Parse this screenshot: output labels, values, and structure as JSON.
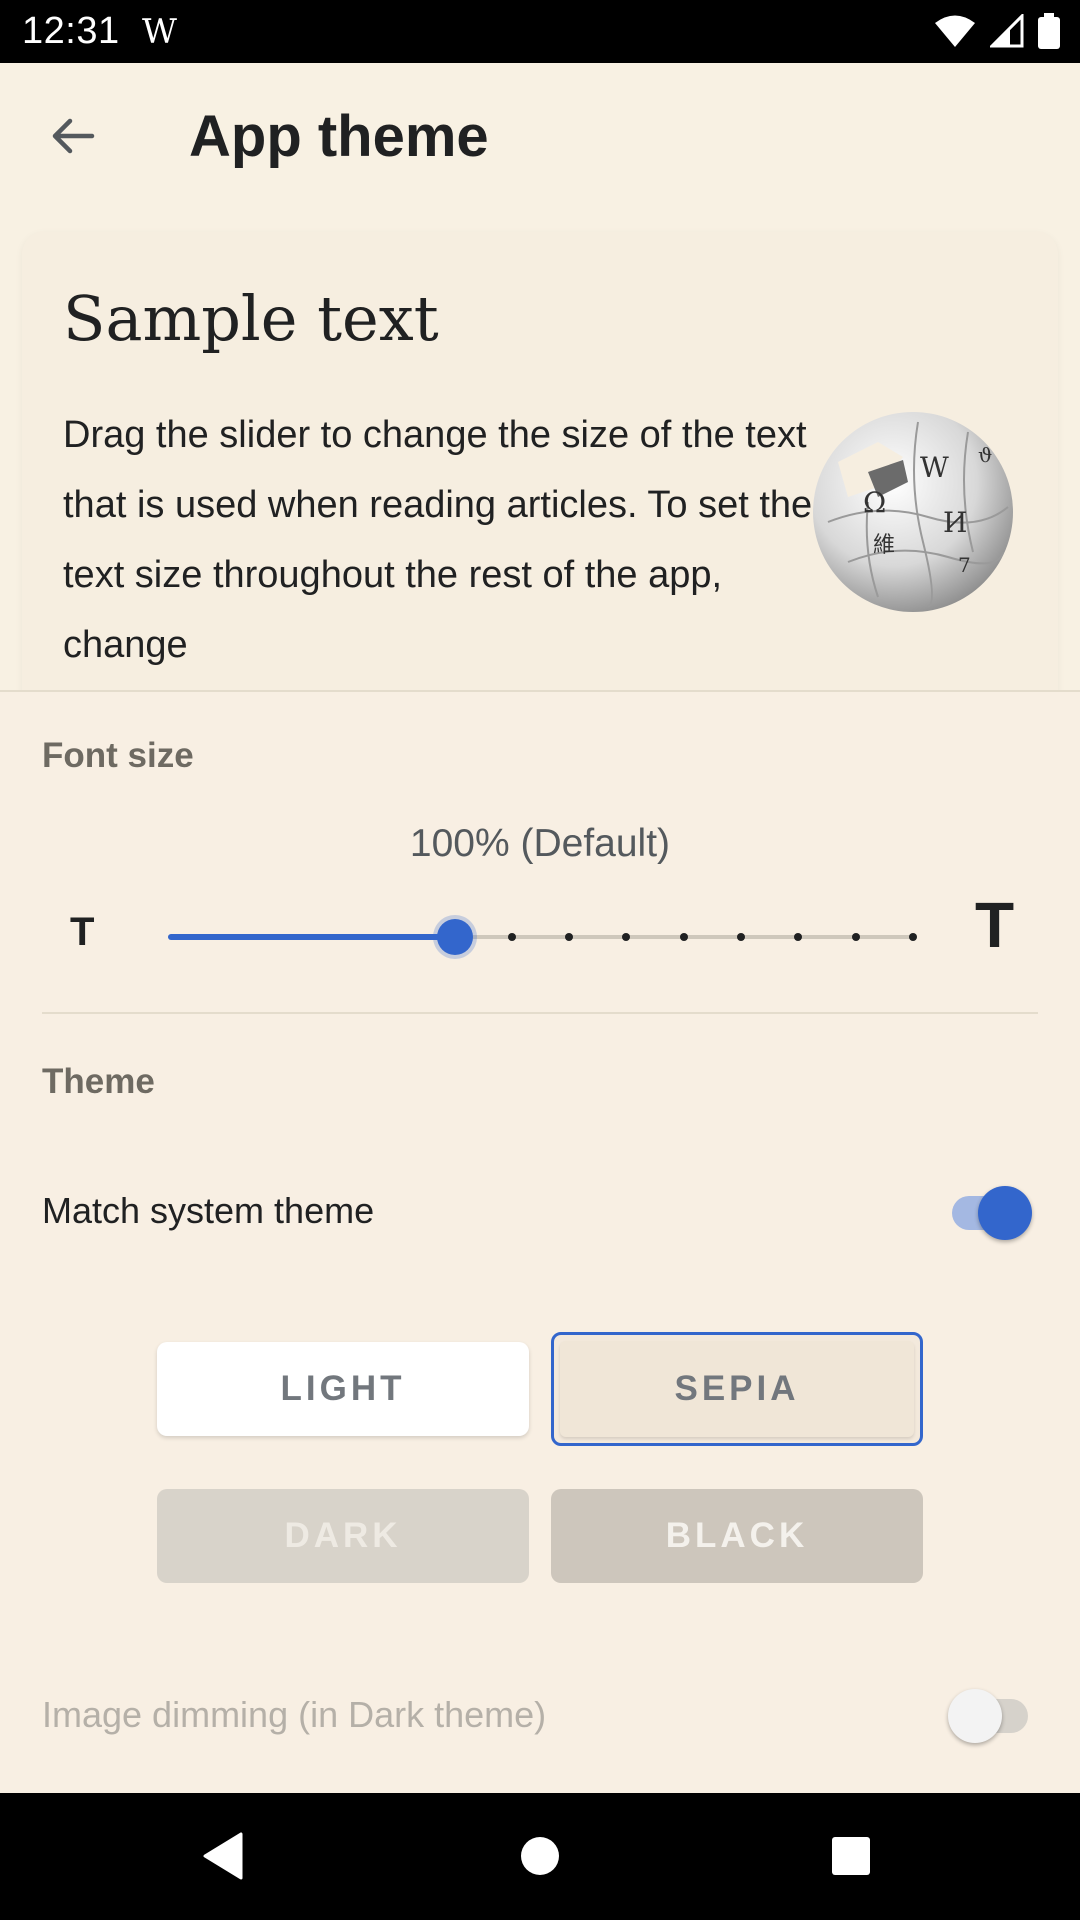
{
  "status_bar": {
    "time": "12:31",
    "notification": "W",
    "icons": [
      "wifi-icon",
      "cellular-signal-icon",
      "battery-icon"
    ]
  },
  "app_bar": {
    "back_icon": "arrow-back-icon",
    "title": "App theme"
  },
  "sample_card": {
    "title": "Sample text",
    "body": "Drag the slider to change the size of the text that is used when reading articles. To set the text size throughout the rest of the app, change",
    "logo_icon": "wikipedia-globe-logo"
  },
  "font_size": {
    "label": "Font size",
    "value_text": "100% (Default)",
    "small_t": "T",
    "large_t": "T",
    "slider": {
      "steps": 14,
      "current_step": 5
    },
    "colors": {
      "accent": "#3366cc"
    }
  },
  "theme": {
    "label": "Theme",
    "match_system_label": "Match system theme",
    "match_system_on": true,
    "buttons": {
      "light": "LIGHT",
      "sepia": "SEPIA",
      "dark": "DARK",
      "black": "BLACK"
    },
    "selected": "SEPIA",
    "image_dimming_label": "Image dimming (in Dark theme)",
    "image_dimming_on": false
  },
  "nav_bar": {
    "icons": [
      "nav-back-icon",
      "nav-home-icon",
      "nav-recents-icon"
    ]
  }
}
